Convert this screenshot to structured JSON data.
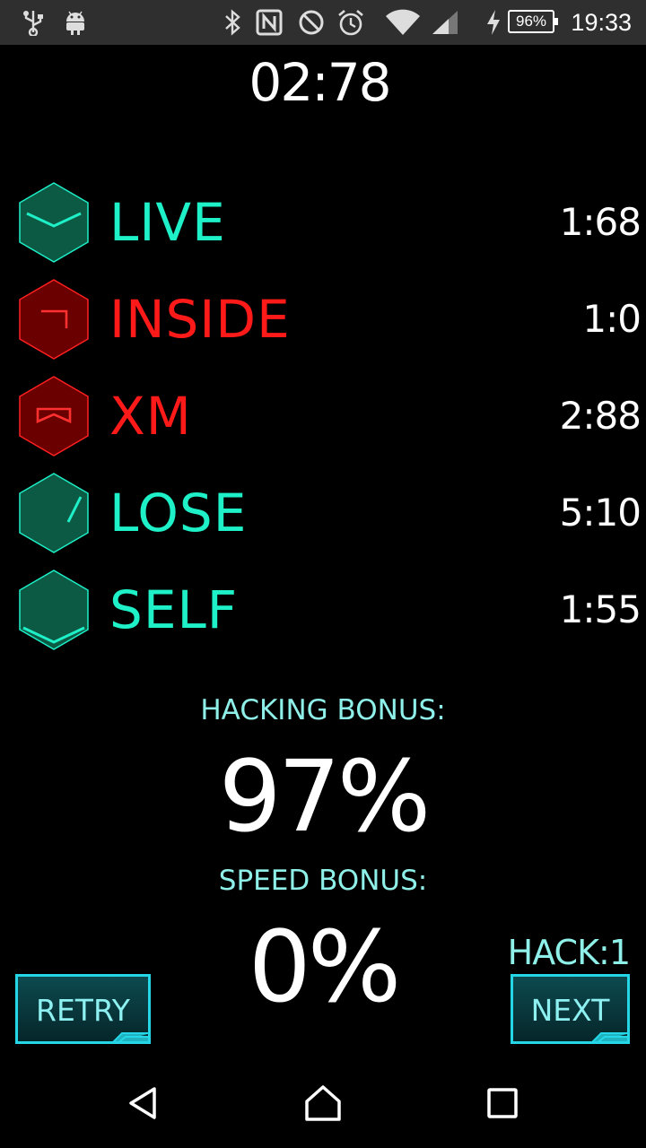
{
  "statusbar": {
    "icons": [
      "usb-icon",
      "android-icon",
      "bluetooth-icon",
      "nfc-icon",
      "do-not-disturb-icon",
      "alarm-icon",
      "wifi-icon",
      "cellular-signal-icon",
      "charging-icon"
    ],
    "battery": "96%",
    "time": "19:33"
  },
  "timer": "02:78",
  "glyphs": [
    {
      "word": "LIVE",
      "time": "1:68",
      "status": "correct",
      "color": "#1ef0c8"
    },
    {
      "word": "INSIDE",
      "time": "1:0",
      "status": "wrong",
      "color": "#ff1a1a"
    },
    {
      "word": "XM",
      "time": "2:88",
      "status": "wrong",
      "color": "#ff1a1a"
    },
    {
      "word": "LOSE",
      "time": "5:10",
      "status": "correct",
      "color": "#1ef0c8"
    },
    {
      "word": "SELF",
      "time": "1:55",
      "status": "correct",
      "color": "#1ef0c8"
    }
  ],
  "hacking_bonus": {
    "label": "HACKING BONUS:",
    "value": "97%"
  },
  "speed_bonus": {
    "label": "SPEED BONUS:",
    "value": "0%"
  },
  "hack_count": "HACK:1",
  "buttons": {
    "retry": "RETRY",
    "next": "NEXT"
  },
  "colors": {
    "accent": "#1ef0c8",
    "error": "#ff1a1a",
    "label": "#8ef0e8",
    "button_border": "#25d6e6"
  },
  "navbar": {
    "icons": [
      "back-icon",
      "home-icon",
      "recents-icon"
    ]
  }
}
